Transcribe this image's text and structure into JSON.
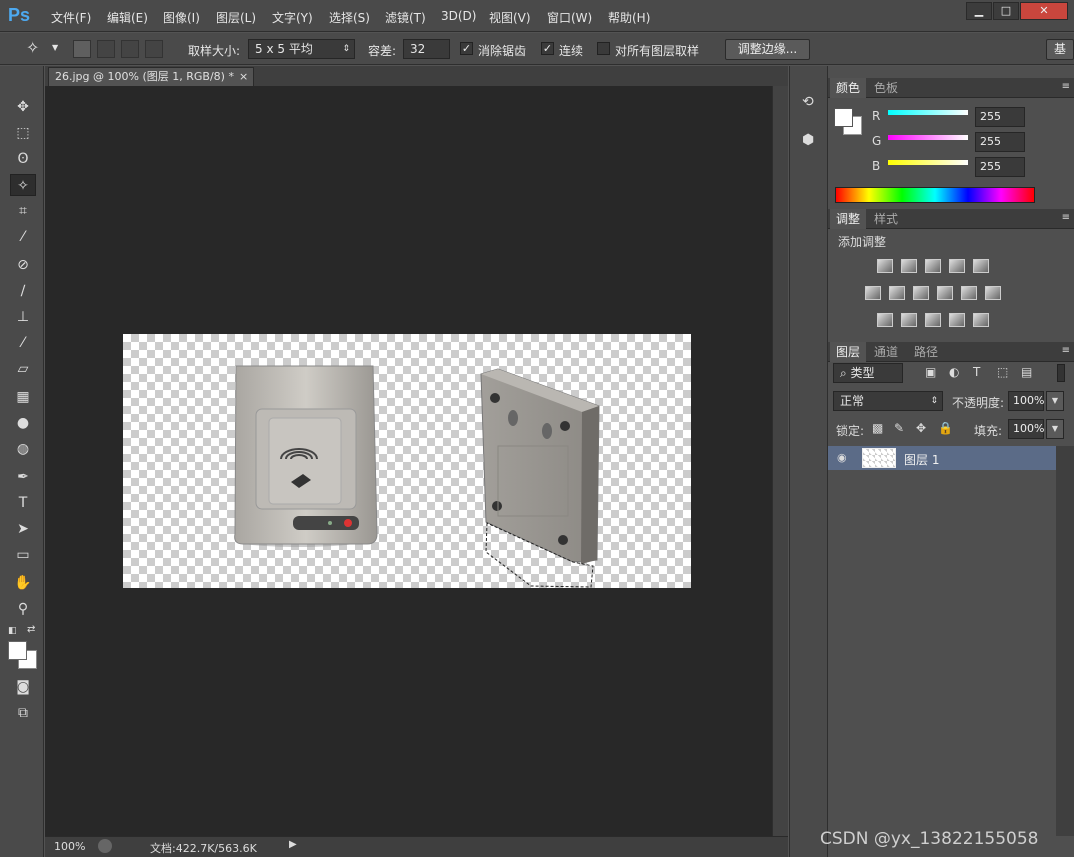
{
  "app": {
    "logo": "Ps"
  },
  "menu": [
    {
      "label": "文件(F)"
    },
    {
      "label": "编辑(E)"
    },
    {
      "label": "图像(I)"
    },
    {
      "label": "图层(L)"
    },
    {
      "label": "文字(Y)"
    },
    {
      "label": "选择(S)"
    },
    {
      "label": "滤镜(T)"
    },
    {
      "label": "3D(D)"
    },
    {
      "label": "视图(V)"
    },
    {
      "label": "窗口(W)"
    },
    {
      "label": "帮助(H)"
    }
  ],
  "window_buttons": {
    "minimize": "▁",
    "maximize": "□",
    "close": "✕"
  },
  "options": {
    "sample_size_label": "取样大小:",
    "sample_size_value": "5 x 5 平均",
    "tolerance_label": "容差:",
    "tolerance_value": "32",
    "antialias_label": "消除锯齿",
    "antialias_checked": true,
    "contiguous_label": "连续",
    "contiguous_checked": true,
    "sample_all_label": "对所有图层取样",
    "sample_all_checked": false,
    "refine_edge_label": "调整边缘...",
    "workspace_label": "基"
  },
  "document": {
    "tab_title": "26.jpg @ 100% (图层 1, RGB/8) *",
    "tab_close": "×",
    "zoom": "100%",
    "doc_info": "文档:422.7K/563.6K"
  },
  "color_panel": {
    "tabs": [
      "颜色",
      "色板"
    ],
    "channels": [
      {
        "label": "R",
        "value": "255"
      },
      {
        "label": "G",
        "value": "255"
      },
      {
        "label": "B",
        "value": "255"
      }
    ]
  },
  "adjust_panel": {
    "tabs": [
      "调整",
      "样式"
    ],
    "title": "添加调整"
  },
  "layers_panel": {
    "tabs": [
      "图层",
      "通道",
      "路径"
    ],
    "filter_kind": "类型",
    "blend_mode": "正常",
    "opacity_label": "不透明度:",
    "opacity_value": "100%",
    "lock_label": "锁定:",
    "fill_label": "填充:",
    "fill_value": "100%",
    "layers": [
      {
        "name": "图层 1",
        "visible": true
      }
    ]
  },
  "watermark": "CSDN @yx_13822155058"
}
